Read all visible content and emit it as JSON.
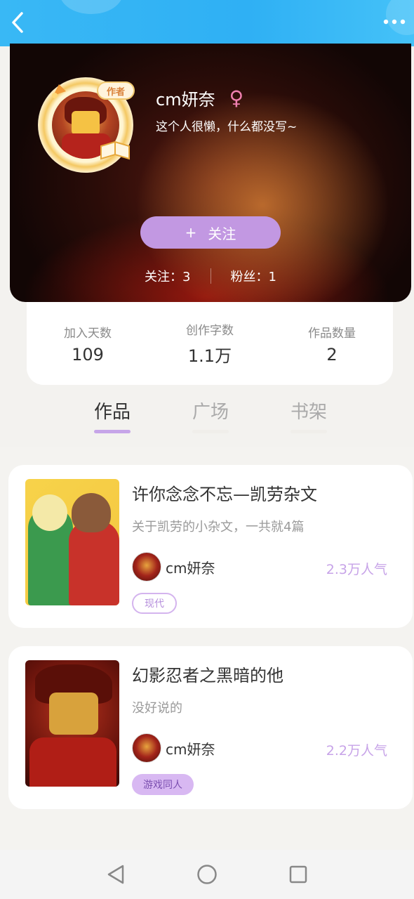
{
  "header": {
    "back_icon": "chevron-left-icon",
    "more_icon": "more-dots-icon",
    "color": "#2fb0f4"
  },
  "profile": {
    "author_badge": "作者",
    "username": "cm妍奈",
    "gender_symbol": "♀",
    "bio": "这个人很懒，什么都没写~",
    "follow_button": "关注",
    "follow_plus": "+",
    "following_label": "关注：3",
    "followers_label": "粉丝：1"
  },
  "stats": [
    {
      "label": "加入天数",
      "value": "109"
    },
    {
      "label": "创作字数",
      "value": "1.1万"
    },
    {
      "label": "作品数量",
      "value": "2"
    }
  ],
  "tabs": [
    {
      "label": "作品",
      "active": true
    },
    {
      "label": "广场",
      "active": false
    },
    {
      "label": "书架",
      "active": false
    }
  ],
  "works": [
    {
      "title": "许你念念不忘—凯劳杂文",
      "description": "关于凯劳的小杂文，一共就4篇",
      "author": "cm妍奈",
      "popularity": "2.3万人气",
      "tag": "现代"
    },
    {
      "title": "幻影忍者之黑暗的他",
      "description": "没好说的",
      "author": "cm妍奈",
      "popularity": "2.2万人气",
      "tag": "游戏同人"
    }
  ],
  "navbar": {
    "icons": [
      "back-triangle-icon",
      "home-circle-icon",
      "recents-square-icon"
    ]
  },
  "colors": {
    "accent": "#c298e2",
    "popularity": "#c7a3e8"
  }
}
